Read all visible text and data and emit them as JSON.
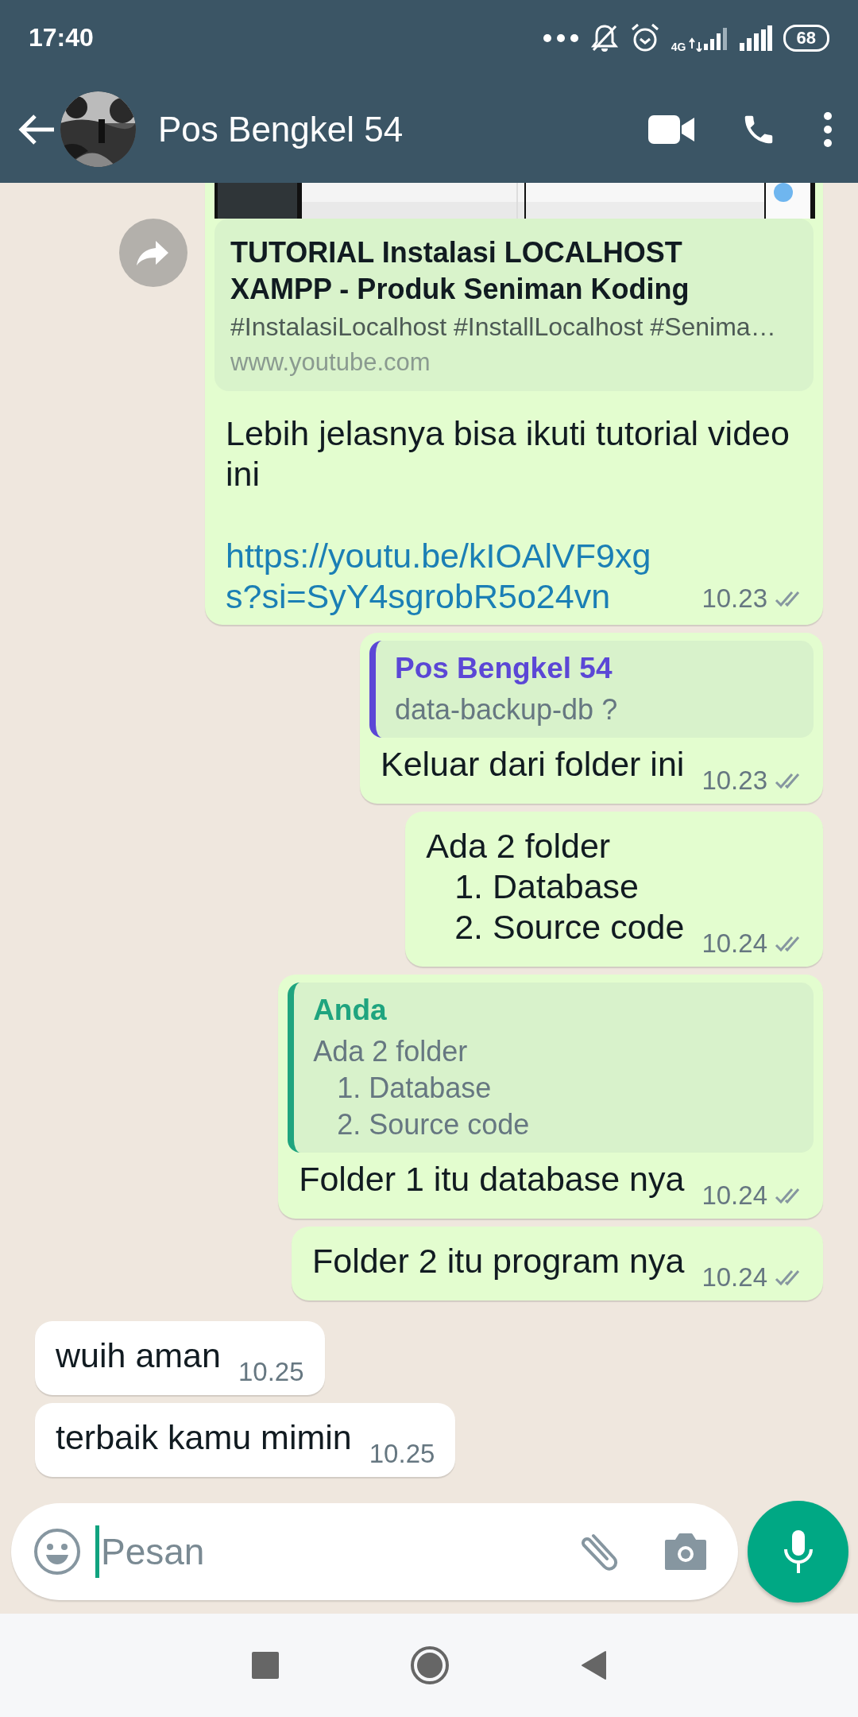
{
  "status_bar": {
    "time": "17:40",
    "network": "4G",
    "battery": "68"
  },
  "header": {
    "title": "Pos Bengkel 54"
  },
  "messages": [
    {
      "kind": "link_preview",
      "outgoing": true,
      "forward_button": true,
      "preview": {
        "title": "TUTORIAL Instalasi LOCALHOST XAMPP - Produk Seniman Koding",
        "description": "#InstalasiLocalhost #InstallLocalhost #Senima…",
        "domain": "www.youtube.com"
      },
      "text": "Lebih jelasnya bisa ikuti tutorial video ini",
      "link": "https://youtu.be/kIOAlVF9xgs?si=SyY4sgrobR5o24vn",
      "time": "10.23",
      "read": false
    },
    {
      "kind": "reply",
      "outgoing": true,
      "quote": {
        "author": "Pos Bengkel 54",
        "text": "data-backup-db ?",
        "color": "#5b47d6"
      },
      "text": "Keluar dari folder ini",
      "time": "10.23",
      "read": false
    },
    {
      "kind": "text",
      "outgoing": true,
      "text": "Ada 2 folder\n   1. Database\n   2. Source code",
      "time": "10.24",
      "read": false
    },
    {
      "kind": "reply",
      "outgoing": true,
      "quote": {
        "author": "Anda",
        "text": "Ada 2 folder\n   1. Database\n   2. Source code",
        "color": "#1fa47f"
      },
      "text": "Folder 1 itu database nya",
      "time": "10.24",
      "read": false
    },
    {
      "kind": "text",
      "outgoing": true,
      "text": "Folder 2 itu program nya",
      "time": "10.24",
      "read": false
    },
    {
      "kind": "text",
      "outgoing": false,
      "text": "wuih aman",
      "time": "10.25"
    },
    {
      "kind": "text",
      "outgoing": false,
      "text": "terbaik kamu mimin",
      "time": "10.25"
    }
  ],
  "composer": {
    "placeholder": "Pesan"
  }
}
